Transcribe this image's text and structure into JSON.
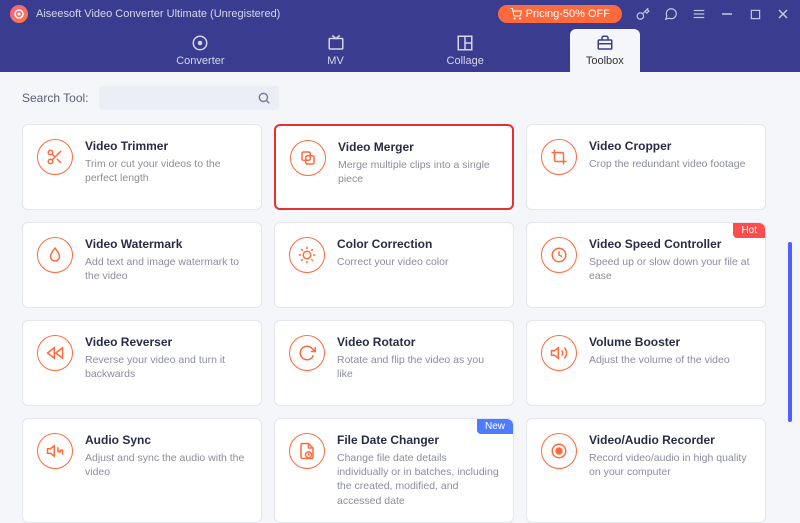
{
  "titlebar": {
    "title": "Aiseesoft Video Converter Ultimate (Unregistered)",
    "pricing_label": "Pricing-50% OFF"
  },
  "tabs": [
    {
      "label": "Converter"
    },
    {
      "label": "MV"
    },
    {
      "label": "Collage"
    },
    {
      "label": "Toolbox"
    }
  ],
  "search": {
    "label": "Search Tool:",
    "placeholder": ""
  },
  "tools": [
    {
      "title": "Video Trimmer",
      "desc": "Trim or cut your videos to the perfect length",
      "icon": "scissors",
      "highlight": false,
      "badge": null
    },
    {
      "title": "Video Merger",
      "desc": "Merge multiple clips into a single piece",
      "icon": "merge",
      "highlight": true,
      "badge": null
    },
    {
      "title": "Video Cropper",
      "desc": "Crop the redundant video footage",
      "icon": "crop",
      "highlight": false,
      "badge": null
    },
    {
      "title": "Video Watermark",
      "desc": "Add text and image watermark to the video",
      "icon": "watermark",
      "highlight": false,
      "badge": null
    },
    {
      "title": "Color Correction",
      "desc": "Correct your video color",
      "icon": "color",
      "highlight": false,
      "badge": null
    },
    {
      "title": "Video Speed Controller",
      "desc": "Speed up or slow down your file at ease",
      "icon": "speed",
      "highlight": false,
      "badge": "Hot"
    },
    {
      "title": "Video Reverser",
      "desc": "Reverse your video and turn it backwards",
      "icon": "reverse",
      "highlight": false,
      "badge": null
    },
    {
      "title": "Video Rotator",
      "desc": "Rotate and flip the video as you like",
      "icon": "rotate",
      "highlight": false,
      "badge": null
    },
    {
      "title": "Volume Booster",
      "desc": "Adjust the volume of the video",
      "icon": "volume",
      "highlight": false,
      "badge": null
    },
    {
      "title": "Audio Sync",
      "desc": "Adjust and sync the audio with the video",
      "icon": "sync",
      "highlight": false,
      "badge": null
    },
    {
      "title": "File Date Changer",
      "desc": "Change file date details individually or in batches, including the created, modified, and accessed date",
      "icon": "date",
      "highlight": false,
      "badge": "New"
    },
    {
      "title": "Video/Audio Recorder",
      "desc": "Record video/audio in high quality on your computer",
      "icon": "record",
      "highlight": false,
      "badge": null
    }
  ]
}
